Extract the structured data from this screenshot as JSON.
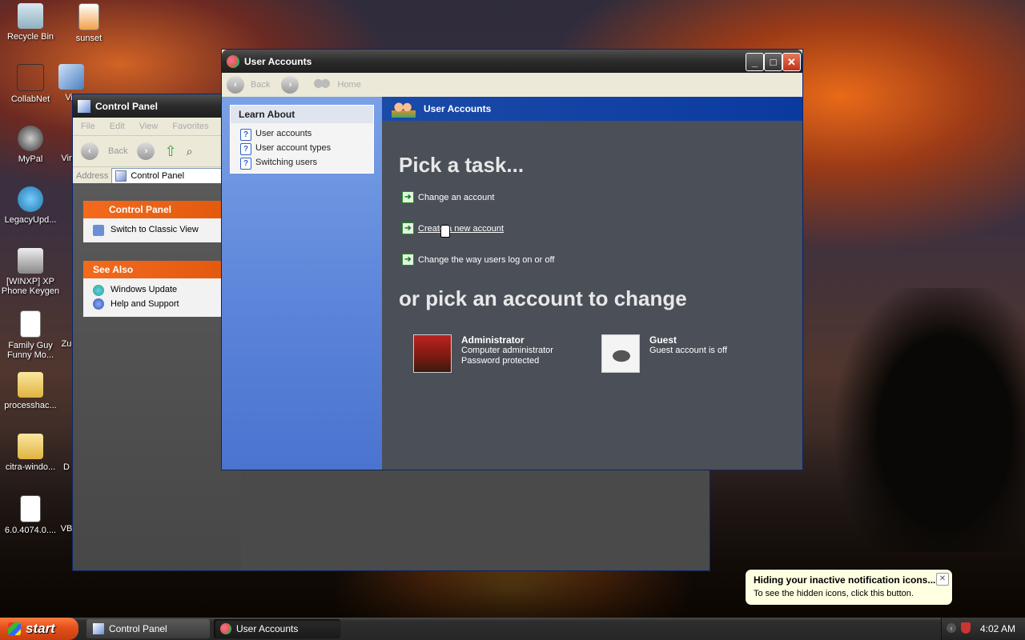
{
  "desktop_icons": [
    {
      "label": "Recycle Bin"
    },
    {
      "label": "sunset"
    },
    {
      "label": "CollabNet"
    },
    {
      "label": "Vir"
    },
    {
      "label": "MyPal"
    },
    {
      "label": "Vir"
    },
    {
      "label": "LegacyUpd..."
    },
    {
      "label": "[WINXP] XP Phone Keygen"
    },
    {
      "label": "Family Guy Funny Mo..."
    },
    {
      "label": "Zu"
    },
    {
      "label": "processhac..."
    },
    {
      "label": "citra-windo..."
    },
    {
      "label": "D"
    },
    {
      "label": "6.0.4074.0...."
    },
    {
      "label": "VB"
    }
  ],
  "control_panel": {
    "title": "Control Panel",
    "menu": [
      "File",
      "Edit",
      "View",
      "Favorites",
      "T"
    ],
    "back_label": "Back",
    "address_label": "Address",
    "address_value": "Control Panel",
    "panel_box": {
      "title": "Control Panel",
      "item": "Switch to Classic View"
    },
    "see_also": {
      "title": "See Also",
      "items": [
        "Windows Update",
        "Help and Support"
      ]
    }
  },
  "user_accounts": {
    "title": "User Accounts",
    "nav": {
      "back": "Back",
      "home": "Home"
    },
    "learn_about": {
      "title": "Learn About",
      "items": [
        "User accounts",
        "User account types",
        "Switching users"
      ]
    },
    "header": "User Accounts",
    "pick_task": "Pick a task...",
    "tasks": [
      "Change an account",
      "Create a new account",
      "Change the way users log on or off"
    ],
    "pick_account": "or pick an account to change",
    "accounts": [
      {
        "name": "Administrator",
        "line1": "Computer administrator",
        "line2": "Password protected"
      },
      {
        "name": "Guest",
        "line1": "Guest account is off",
        "line2": ""
      }
    ]
  },
  "taskbar": {
    "start_label": "start",
    "items": [
      "Control Panel",
      "User Accounts"
    ],
    "clock": "4:02 AM"
  },
  "balloon": {
    "title": "Hiding your inactive notification icons...",
    "body": "To see the hidden icons, click this button."
  },
  "colors": {
    "xp_blue_header": "#0a3aa0",
    "orange_box_header": "#e35a0f",
    "start_button": "#e4501b"
  }
}
